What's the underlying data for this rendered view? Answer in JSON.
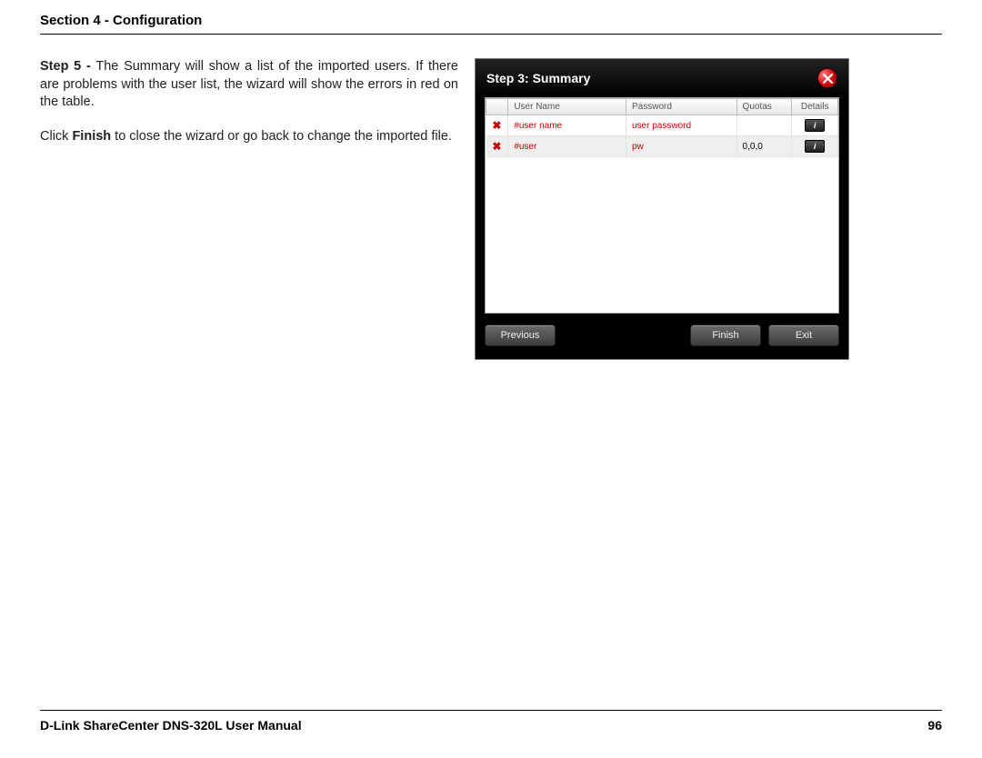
{
  "header": {
    "section_title": "Section 4 - Configuration"
  },
  "instructions": {
    "step_label": "Step 5 - ",
    "p1": "The Summary will show a list of the imported users. If there are problems with the user list, the wizard will show the errors in red on the table.",
    "p2a": "Click ",
    "p2_bold": "Finish",
    "p2b": " to close the wizard or go back to change the imported file."
  },
  "wizard": {
    "title": "Step 3: Summary",
    "columns": {
      "c1": "User Name",
      "c2": "Password",
      "c3": "Quotas",
      "c4": "Details"
    },
    "rows": [
      {
        "name": "#user name",
        "password": "user password",
        "quotas": "",
        "error": true
      },
      {
        "name": "#user",
        "password": "pw",
        "quotas": "0,0,0",
        "error": true
      }
    ],
    "buttons": {
      "previous": "Previous",
      "finish": "Finish",
      "exit": "Exit"
    },
    "info_glyph": "i",
    "x_glyph": "✖"
  },
  "footer": {
    "manual": "D-Link ShareCenter DNS-320L User Manual",
    "page": "96"
  }
}
